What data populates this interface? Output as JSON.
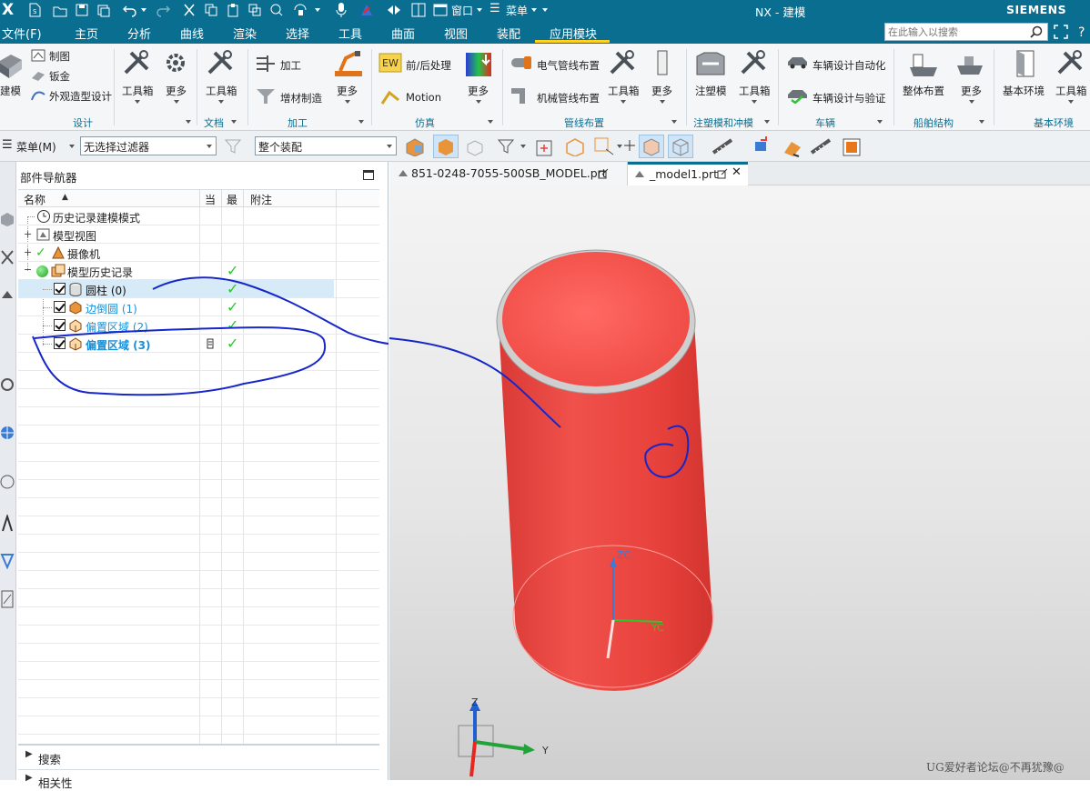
{
  "titlebar": {
    "app_letter": "X",
    "window_menu": "窗口",
    "menu_label": "菜单",
    "title": "NX - 建模",
    "brand": "SIEMENS"
  },
  "menubar": {
    "items": [
      "文件(F)",
      "主页",
      "分析",
      "曲线",
      "渲染",
      "选择",
      "工具",
      "曲面",
      "视图",
      "装配",
      "应用模块"
    ],
    "active": "应用模块",
    "search_placeholder": "在此输入以搜索"
  },
  "ribbon": {
    "design": {
      "partial_label": "建模",
      "drafting": "制图",
      "sheet_metal": "钣金",
      "styling": "外观造型设计",
      "group": "设计"
    },
    "toolbox1": {
      "toolbox": "工具箱",
      "more": "更多"
    },
    "doc": {
      "toolbox": "工具箱",
      "group": "文档"
    },
    "mfg": {
      "machining": "加工",
      "additive": "增材制造",
      "more": "更多",
      "group": "加工"
    },
    "sim": {
      "prepost": "前/后处理",
      "motion": "Motion",
      "more": "更多",
      "group": "仿真"
    },
    "routing": {
      "electrical": "电气管线布置",
      "mechanical": "机械管线布置",
      "toolbox": "工具箱",
      "more": "更多",
      "group": "管线布置"
    },
    "mold": {
      "dieface": "注塑模",
      "toolbox": "工具箱",
      "group": "注塑模和冲模"
    },
    "vehicle": {
      "auto_design": "车辆设计自动化",
      "verify": "车辆设计与验证",
      "group": "车辆"
    },
    "ship": {
      "layout": "整体布置",
      "more": "更多",
      "group": "船舶结构"
    },
    "basic": {
      "env": "基本环境",
      "toolbox": "工具箱",
      "group": "基本环境"
    }
  },
  "selbar": {
    "menu_label": "菜单(M)",
    "filter_value": "无选择过滤器",
    "scope_value": "整个装配"
  },
  "navigator": {
    "title": "部件导航器",
    "columns": {
      "name": "名称",
      "current": "当",
      "latest": "最",
      "note": "附注"
    },
    "rows": [
      {
        "label": "历史记录建模模式"
      },
      {
        "label": "模型视图"
      },
      {
        "label": "摄像机"
      },
      {
        "label": "模型历史记录"
      },
      {
        "label": "圆柱 (0)"
      },
      {
        "label": "边倒圆 (1)"
      },
      {
        "label": "偏置区域 (2)"
      },
      {
        "label": "偏置区域 (3)"
      }
    ],
    "search_label": "搜索",
    "related_label": "相关性"
  },
  "tabs": [
    {
      "label": "851-0248-7055-500SB_MODEL.prt"
    },
    {
      "label": "_model1.prt"
    }
  ],
  "viewport": {
    "axis_zc": "ZC",
    "axis_yc": "YC",
    "axis_z": "Z",
    "axis_y": "Y",
    "watermark": "UG爱好者论坛@不再犹豫@"
  },
  "colors": {
    "header_blue": "#0a6e91",
    "cylinder_red": "#e8413c",
    "link_blue": "#1b8fd6",
    "check_green": "#2fc52f"
  }
}
